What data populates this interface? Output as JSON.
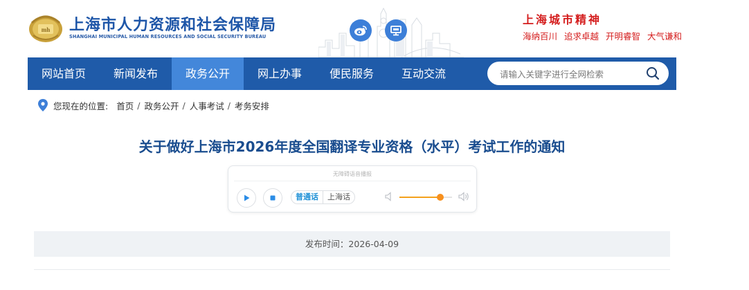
{
  "header": {
    "title": "上海市人力资源和社会保障局",
    "subtitle": "SHANGHAI MUNICIPAL HUMAN RESOURCES AND SOCIAL SECURITY BUREAU",
    "logo_icon": "government-emblem-icon",
    "social_icons": [
      "weibo-icon",
      "screen-icon"
    ],
    "spirit_title": "上海城市精神",
    "spirit_slogans": [
      "海纳百川",
      "追求卓越",
      "开明睿智",
      "大气谦和"
    ],
    "brand_color": "#1e56a8",
    "slogan_color": "#d41c1c"
  },
  "nav": {
    "items": [
      {
        "label": "网站首页"
      },
      {
        "label": "新闻发布"
      },
      {
        "label": "政务公开"
      },
      {
        "label": "网上办事"
      },
      {
        "label": "便民服务"
      },
      {
        "label": "互动交流"
      }
    ],
    "active_index": 2,
    "bar_color": "#1f5ba9",
    "active_color": "#4387da",
    "search": {
      "placeholder": "请输入关键字进行全网检索",
      "value": ""
    }
  },
  "breadcrumb": {
    "prefix": "您现在的位置:",
    "items": [
      "首页",
      "政务公开",
      "人事考试",
      "考务安排"
    ]
  },
  "article": {
    "title": "关于做好上海市2026年度全国翻译专业资格（水平）考试工作的通知"
  },
  "player": {
    "caption": "无障碍语音播报",
    "dialects": [
      "普通话",
      "上海话"
    ],
    "selected_dialect": "普通话",
    "volume": 0.78
  },
  "publish": {
    "text": "发布时间：2026-04-09"
  }
}
